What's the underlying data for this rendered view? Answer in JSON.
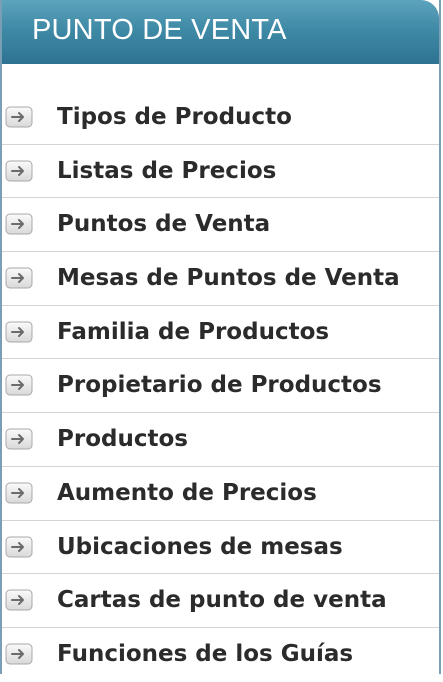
{
  "header": {
    "title": "PUNTO DE VENTA"
  },
  "icons": {
    "item_icon": "arrow-right-icon"
  },
  "colors": {
    "header_top": "#5da3bd",
    "header_bottom": "#2e7391",
    "border": "#7a9fb4",
    "text": "#2b2b2b",
    "divider": "#d4d4d4"
  },
  "menu": {
    "items": [
      {
        "label": "Tipos de Producto"
      },
      {
        "label": "Listas de Precios"
      },
      {
        "label": "Puntos de Venta"
      },
      {
        "label": "Mesas de Puntos de Venta"
      },
      {
        "label": "Familia de Productos"
      },
      {
        "label": "Propietario de Productos"
      },
      {
        "label": "Productos"
      },
      {
        "label": "Aumento de Precios"
      },
      {
        "label": "Ubicaciones de mesas"
      },
      {
        "label": "Cartas de punto de venta"
      },
      {
        "label": "Funciones de los Guías"
      }
    ]
  }
}
